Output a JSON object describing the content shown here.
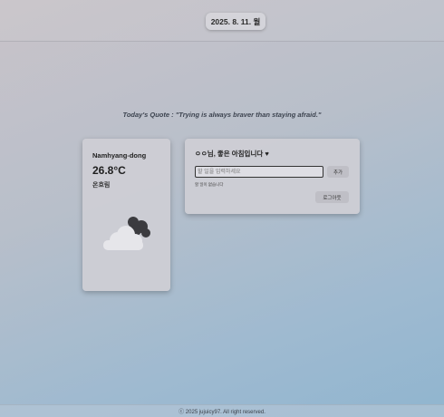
{
  "header": {
    "date": "2025. 8. 11. 월"
  },
  "quote": {
    "text": "Today's Quote : \"Trying is always braver than staying afraid.\""
  },
  "weather": {
    "location": "Namhyang-dong",
    "temperature": "26.8°C",
    "description": "온흐림",
    "icon": "partly-cloudy-icon"
  },
  "todo": {
    "greeting": "ㅇㅇ님, 좋은 아침입니다 ♥",
    "input_placeholder": "할 일을 입력하세요",
    "add_label": "추가",
    "empty_text": "할 일이 없습니다",
    "logout_label": "로그아웃"
  },
  "footer": {
    "copyright": "ⓒ 2025 jujuicy97. All right reserved."
  }
}
